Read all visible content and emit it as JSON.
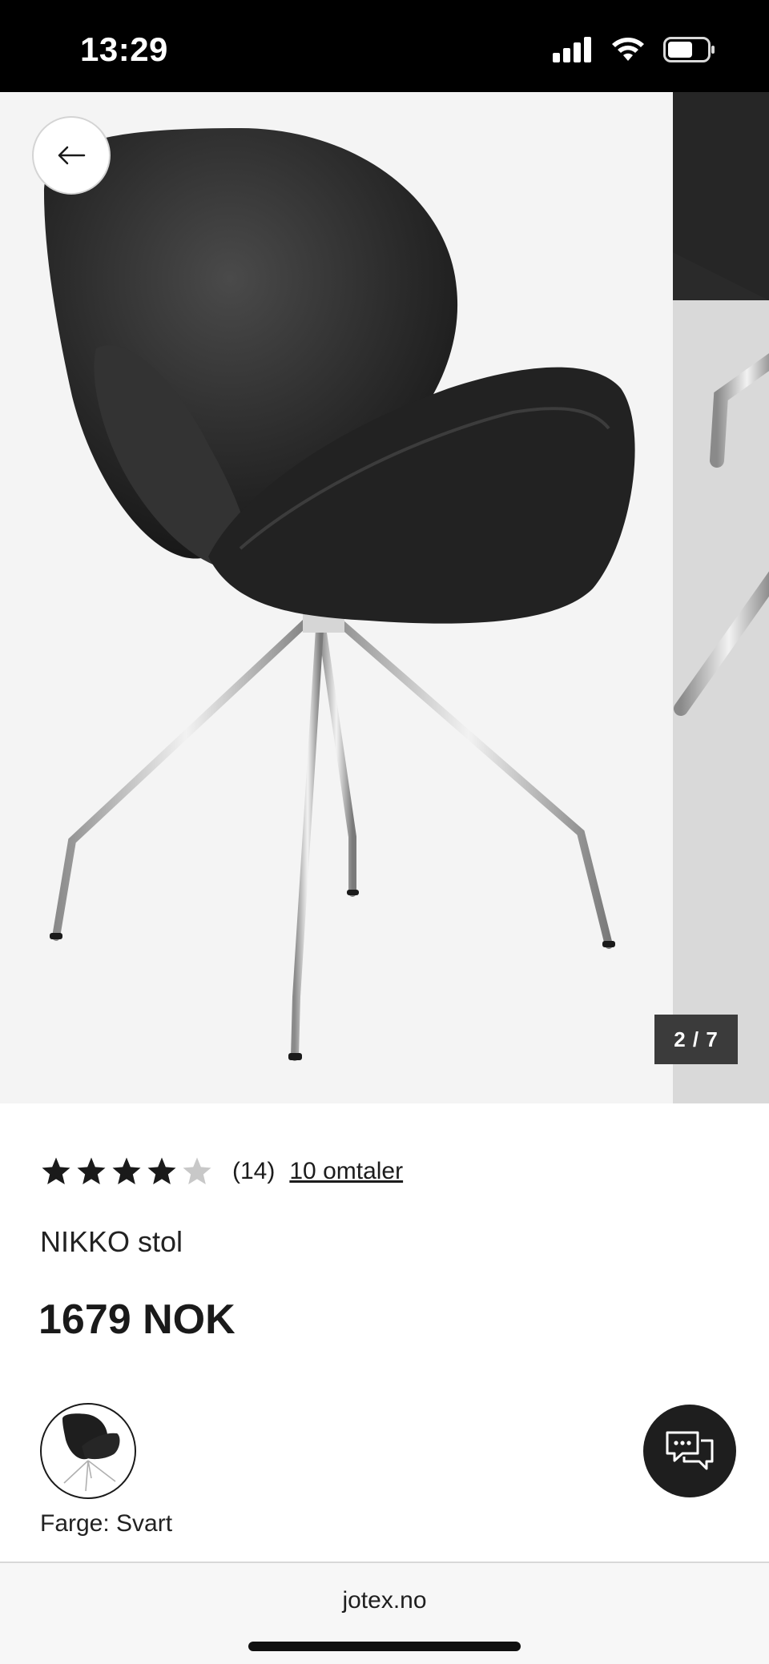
{
  "status_bar": {
    "time": "13:29",
    "icons": [
      "signal-icon",
      "wifi-icon",
      "battery-icon"
    ]
  },
  "gallery": {
    "slide_counter": "2 / 7",
    "current_slide": 2,
    "total_slides": 7,
    "back_icon": "arrow-left-icon"
  },
  "product": {
    "rating_value": 4,
    "rating_max": 5,
    "rating_count": "(14)",
    "reviews_link": "10 omtaler",
    "name": "NIKKO stol",
    "price": "1679 NOK",
    "color_label": "Farge: Svart"
  },
  "chat": {
    "icon": "chat-bubbles-icon"
  },
  "browser": {
    "url": "jotex.no"
  },
  "colors": {
    "star_filled": "#1a1a1a",
    "star_empty": "#c8c8c8",
    "counter_bg": "#3b3b3b",
    "chat_bg": "#1e1e1e"
  }
}
